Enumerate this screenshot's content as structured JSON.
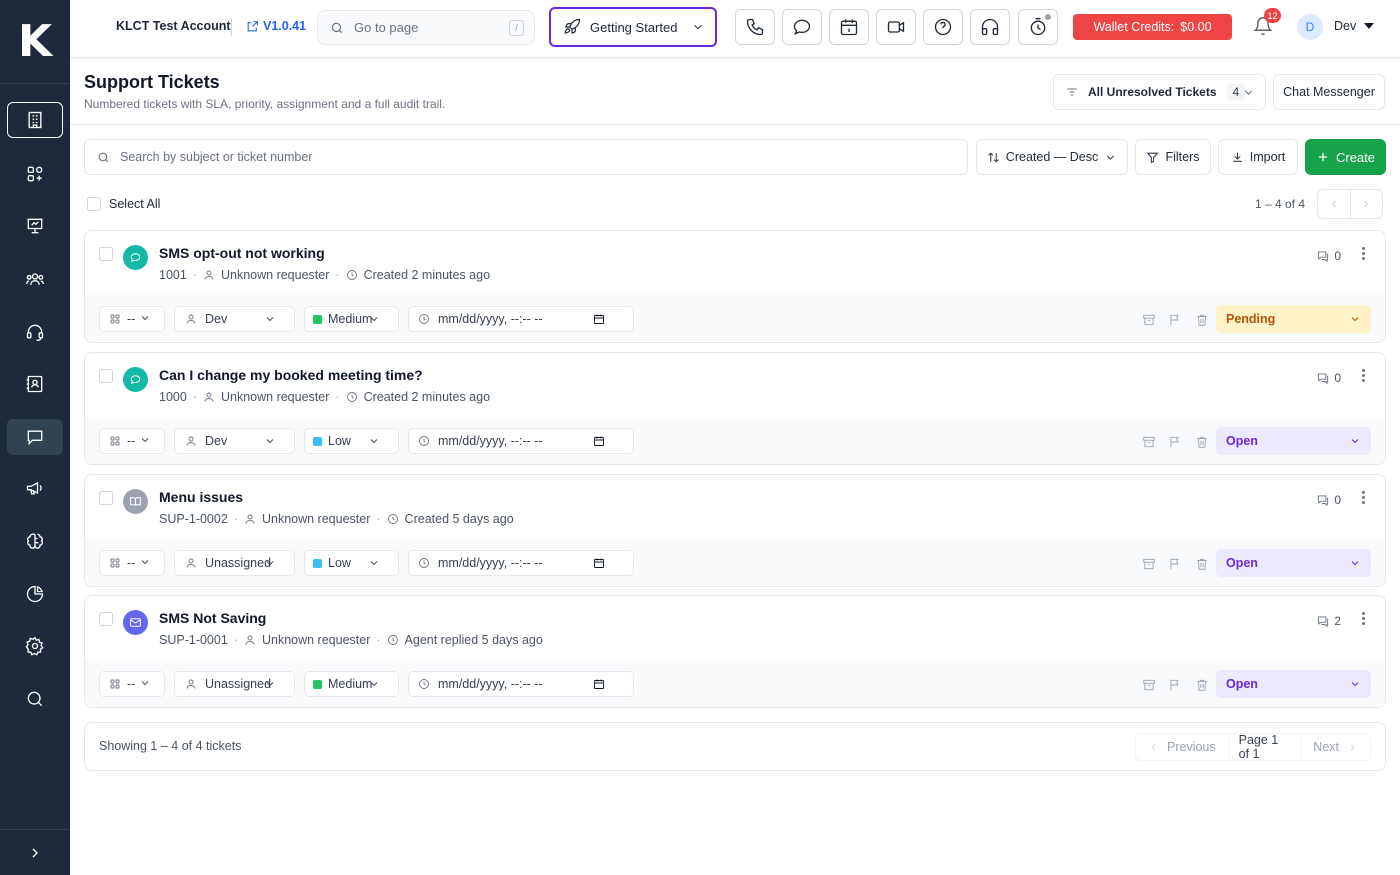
{
  "brand": {
    "logo_letter": "K"
  },
  "sidebar": {
    "items": [
      {
        "name": "building-icon"
      },
      {
        "name": "apps-grid-icon"
      },
      {
        "name": "presentation-icon"
      },
      {
        "name": "users-icon"
      },
      {
        "name": "headset-icon"
      },
      {
        "name": "contacts-icon"
      },
      {
        "name": "chat-icon",
        "active": true
      },
      {
        "name": "megaphone-icon"
      },
      {
        "name": "brain-icon"
      },
      {
        "name": "pie-chart-icon"
      },
      {
        "name": "gear-icon"
      },
      {
        "name": "search-icon"
      }
    ],
    "expand_icon": "chevron-right-icon"
  },
  "topbar": {
    "account": "KLCT Test Account",
    "version": "V1.0.41",
    "goto_placeholder": "Go to page",
    "goto_shortcut": "/",
    "getting_started": "Getting Started",
    "icons": [
      "phone-icon",
      "chat-bubble-icon",
      "calendar-icon",
      "video-icon",
      "help-icon",
      "headphones-icon",
      "clock-icon"
    ],
    "wallet_label": "Wallet Credits:",
    "wallet_value": "$0.00",
    "notification_count": "12",
    "user_initial": "D",
    "user_name": "Dev"
  },
  "header": {
    "title": "Support Tickets",
    "subtitle": "Numbered tickets with SLA, priority, assignment and a full audit trail.",
    "view_label": "All Unresolved Tickets",
    "view_count": "4",
    "chat_messenger": "Chat Messenger"
  },
  "toolbar": {
    "search_placeholder": "Search by subject or ticket number",
    "sort_label": "Created — Desc",
    "filters_label": "Filters",
    "import_label": "Import",
    "create_label": "Create"
  },
  "list": {
    "select_all": "Select All",
    "range": "1 – 4 of 4"
  },
  "colors": {
    "accent_green": "#16a34a",
    "wallet_red": "#ef4444",
    "getting_started_border": "#6d28d9",
    "pending_bg": "#fef3c7",
    "open_bg": "#ede9fe",
    "priority_medium": "#22c55e",
    "priority_low": "#38bdf8"
  },
  "tickets": [
    {
      "title": "SMS opt-out not working",
      "number": "1001",
      "requester": "Unknown requester",
      "activity": "Created 2 minutes ago",
      "comments": "0",
      "channel": "chat",
      "channel_color": "#14b8a6",
      "team": "--",
      "assignee": "Dev",
      "priority": "Medium",
      "priority_color": "#22c55e",
      "due_placeholder": "mm/dd/yyyy, --:-- --",
      "status": "Pending",
      "status_bg": "#fef3c7",
      "status_color": "#b45309"
    },
    {
      "title": "Can I change my booked meeting time?",
      "number": "1000",
      "requester": "Unknown requester",
      "activity": "Created 2 minutes ago",
      "comments": "0",
      "channel": "chat",
      "channel_color": "#14b8a6",
      "team": "--",
      "assignee": "Dev",
      "priority": "Low",
      "priority_color": "#38bdf8",
      "due_placeholder": "mm/dd/yyyy, --:-- --",
      "status": "Open",
      "status_bg": "#ede9fe",
      "status_color": "#6d28d9"
    },
    {
      "title": "Menu issues",
      "number": "SUP-1-0002",
      "requester": "Unknown requester",
      "activity": "Created 5 days ago",
      "comments": "0",
      "channel": "book",
      "channel_color": "#9ca3af",
      "team": "--",
      "assignee": "Unassigned",
      "priority": "Low",
      "priority_color": "#38bdf8",
      "due_placeholder": "mm/dd/yyyy, --:-- --",
      "status": "Open",
      "status_bg": "#ede9fe",
      "status_color": "#6d28d9"
    },
    {
      "title": "SMS Not Saving",
      "number": "SUP-1-0001",
      "requester": "Unknown requester",
      "activity": "Agent replied 5 days ago",
      "comments": "2",
      "channel": "email",
      "channel_color": "#6366f1",
      "team": "--",
      "assignee": "Unassigned",
      "priority": "Medium",
      "priority_color": "#22c55e",
      "due_placeholder": "mm/dd/yyyy, --:-- --",
      "status": "Open",
      "status_bg": "#ede9fe",
      "status_color": "#6d28d9"
    }
  ],
  "footer": {
    "showing": "Showing 1 – 4 of 4 tickets",
    "previous": "Previous",
    "page": "Page 1 of 1",
    "next": "Next"
  }
}
